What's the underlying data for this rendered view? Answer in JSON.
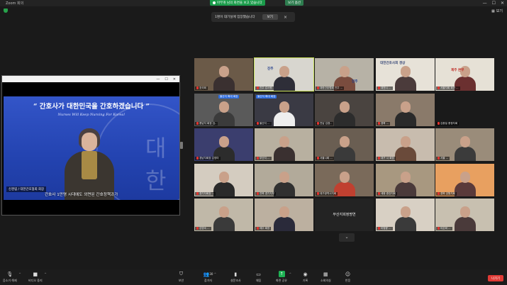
{
  "window": {
    "title": "Zoom 회의",
    "share_banner": "아무개 님의 화면을 보고 있습니다",
    "view_options": "보기 옵션",
    "controls": [
      "—",
      "☐",
      "✕"
    ],
    "view_toggle": "보기"
  },
  "waiting_room": {
    "message": "1명이 대기실에 입장했습니다",
    "view_button": "보기",
    "close": "×"
  },
  "presenter": {
    "window_controls": [
      "—",
      "☐",
      "✕"
    ],
    "slide_headline": "“ 간호사가 대한민국을 간호하겠습니다 ”",
    "slide_subline": "Nurses Will Keep Nursing For Korea!",
    "seal_text": "대한간",
    "name_tag": "신경림 / 대한간호협회 회장",
    "caption": "간호사 1만명 시대에도 외면된 간호정책과가"
  },
  "gallery": {
    "tiles": [
      {
        "label": "호국회",
        "muted": true,
        "active": false
      },
      {
        "label": "진주 감사원",
        "muted": true,
        "active": true
      },
      {
        "label": "대한간호협회 진주 ...",
        "muted": true,
        "active": false
      },
      {
        "label": "대전시 ...",
        "muted": true,
        "active": false
      },
      {
        "label": "서울지회 회관 ...",
        "muted": true,
        "active": false
      },
      {
        "label": "충남지 회장 김..",
        "muted": true,
        "active": false
      },
      {
        "label": "울산지 ...",
        "muted": true,
        "active": false
      },
      {
        "label": "전남 김경..",
        "muted": true,
        "active": false
      },
      {
        "label": "경북 ...",
        "muted": true,
        "active": false
      },
      {
        "label": "김종일 충청지회",
        "muted": true,
        "active": false
      },
      {
        "label": "경남지회장 김영미",
        "muted": true,
        "active": false
      },
      {
        "label": "부산지 ...",
        "muted": true,
        "active": false
      },
      {
        "label": "서울시회 ...",
        "muted": true,
        "active": false
      },
      {
        "label": "대구 시 회장",
        "muted": true,
        "active": false
      },
      {
        "label": "서울 ...",
        "muted": true,
        "active": false
      },
      {
        "label": "경기지회장 ...",
        "muted": true,
        "active": false
      },
      {
        "label": "전북 경기지부",
        "muted": true,
        "active": false
      },
      {
        "label": "대구광역시지회",
        "muted": true,
        "active": false
      },
      {
        "label": "세종 중앙지회",
        "muted": true,
        "active": false
      },
      {
        "label": "경북 강원지회",
        "muted": true,
        "active": false
      },
      {
        "label": "김영숙 ...",
        "muted": true,
        "active": false
      },
      {
        "label": "제주 회장",
        "muted": true,
        "active": false
      },
      {
        "label": "부산지회정명연",
        "muted": false,
        "active": false,
        "name_only": true
      },
      {
        "label": "이정윤 ...",
        "muted": true,
        "active": false
      },
      {
        "label": "이은희 ...",
        "muted": true,
        "active": false
      }
    ],
    "pill_labels": [
      "울산지 확대 회장",
      "울산지 확대 회장"
    ],
    "banner_texts": [
      "진주",
      "진주",
      "대한간호사회 경상",
      "제주 본부"
    ],
    "next_arrow": "⌄"
  },
  "toolbar": {
    "items": [
      {
        "label": "음소거 해제",
        "icon": "mic-muted-icon"
      },
      {
        "label": "비디오 중지",
        "icon": "video-icon"
      },
      {
        "label": "보안",
        "icon": "shield-icon"
      },
      {
        "label": "참가자",
        "icon": "participants-icon",
        "count": "30"
      },
      {
        "label": "설문조사",
        "icon": "poll-icon"
      },
      {
        "label": "채팅",
        "icon": "chat-icon"
      },
      {
        "label": "화면 공유",
        "icon": "share-screen-icon"
      },
      {
        "label": "기록",
        "icon": "record-icon"
      },
      {
        "label": "소회의실",
        "icon": "breakout-icon"
      },
      {
        "label": "반응",
        "icon": "reactions-icon"
      }
    ],
    "leave": "나가기"
  },
  "colors": {
    "accent_green": "#1eb254",
    "leave_red": "#e03a35",
    "slide_blue": "#2343b0",
    "active_speaker": "#c9e05a"
  }
}
